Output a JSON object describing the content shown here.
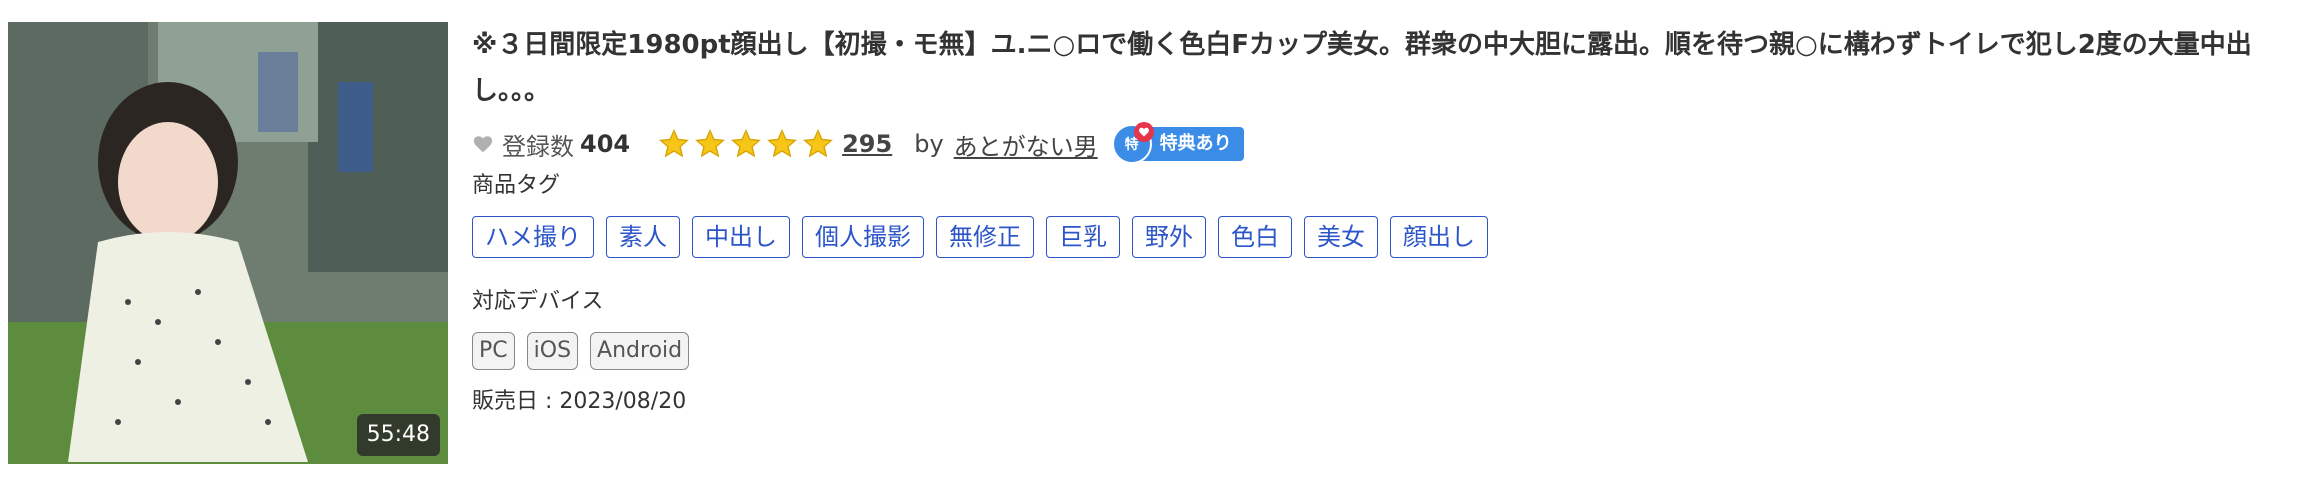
{
  "product": {
    "thumbnail_alt": "product-thumbnail",
    "duration": "55:48",
    "title": "※３日間限定1980pt顔出し【初撮・モ無】ユ.ニ○ロで働く色白Fカップ美女。群衆の中大胆に露出。順を待つ親○に構わずトイレで犯し2度の大量中出し。。。",
    "favorites_label": "登録数",
    "favorites_count": "404",
    "rating_stars": 5,
    "rating_count": "295",
    "by_label": "by",
    "seller": "あとがない男",
    "badge_icon_label": "特",
    "badge_label": "特典あり",
    "tags_label": "商品タグ",
    "tags": [
      "ハメ撮り",
      "素人",
      "中出し",
      "個人撮影",
      "無修正",
      "巨乳",
      "野外",
      "色白",
      "美女",
      "顔出し"
    ],
    "devices_label": "対応デバイス",
    "devices": [
      "PC",
      "iOS",
      "Android"
    ],
    "release_label": "販売日 : 2023/08/20"
  },
  "colors": {
    "tag_border": "#2c55c8",
    "star": "#f5c518",
    "badge": "#3b8ce6",
    "badge_heart": "#e8344a"
  }
}
